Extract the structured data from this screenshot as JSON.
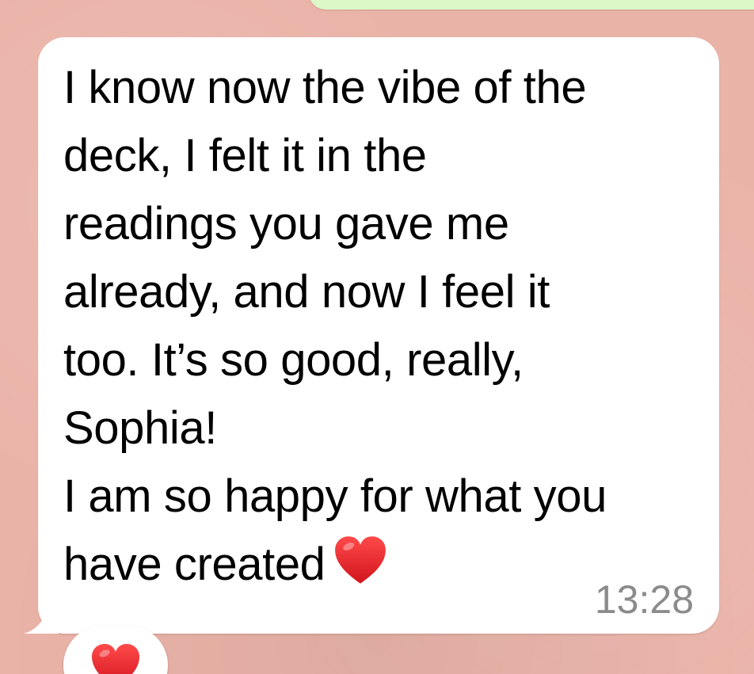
{
  "message": {
    "lines": [
      "I know now the vibe of the",
      "deck, I felt it in the",
      "readings you gave me",
      "already, and now I feel it",
      "too. It’s so good, really,",
      "Sophia!",
      "I am so happy for what you"
    ],
    "last_line_text": "have created",
    "emoji_icon": "red-heart-icon",
    "timestamp": "13:28"
  },
  "reaction": {
    "emoji_icon": "red-heart-icon"
  },
  "colors": {
    "wallpaper": "#eab3a8",
    "incoming_bubble": "#ffffff",
    "outgoing_bubble": "#dcf8c6",
    "timestamp_text": "#8b8b8b",
    "heart": "#e0202a"
  }
}
